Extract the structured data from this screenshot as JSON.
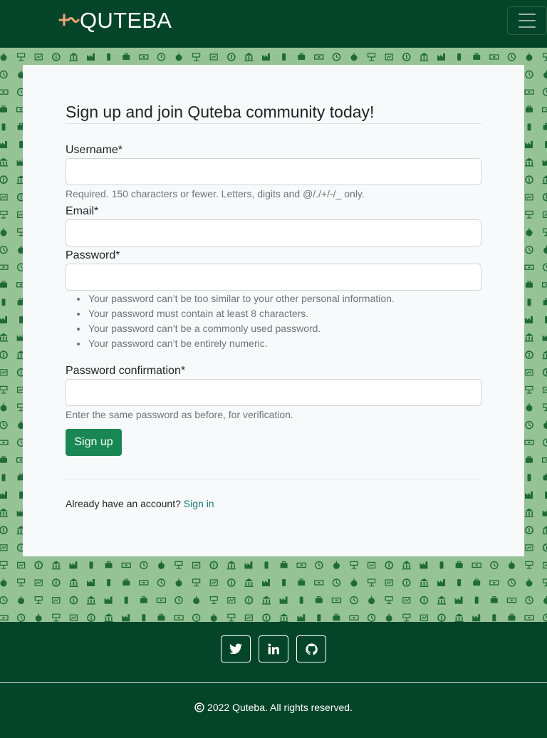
{
  "brand": {
    "name": "QUTEBA",
    "logo_icon": "quteba-logo-icon",
    "logo_color": "#f4a57a"
  },
  "colors": {
    "dark_green": "#044529",
    "pattern_bg": "#96c395",
    "pattern_icons": "#1f6a36",
    "primary": "#198754",
    "link": "#157a7a"
  },
  "nav": {
    "toggle_icon": "hamburger-menu-icon"
  },
  "form": {
    "title": "Sign up and join Quteba community today!",
    "username": {
      "label": "Username*",
      "value": "",
      "help": "Required. 150 characters or fewer. Letters, digits and @/./+/-/_ only."
    },
    "email": {
      "label": "Email*",
      "value": ""
    },
    "password": {
      "label": "Password*",
      "value": "",
      "rules": [
        "Your password can’t be too similar to your other personal information.",
        "Your password must contain at least 8 characters.",
        "Your password can’t be a commonly used password.",
        "Your password can’t be entirely numeric."
      ]
    },
    "password_confirmation": {
      "label": "Password confirmation*",
      "value": "",
      "help": "Enter the same password as before, for verification."
    },
    "submit_label": "Sign up",
    "already_text": "Already have an account?",
    "signin_label": "Sign in"
  },
  "footer": {
    "social": [
      {
        "name": "twitter",
        "icon": "twitter-icon"
      },
      {
        "name": "linkedin",
        "icon": "linkedin-icon"
      },
      {
        "name": "github",
        "icon": "github-icon"
      }
    ],
    "copyright": "2022 Quteba. All rights reserved."
  }
}
